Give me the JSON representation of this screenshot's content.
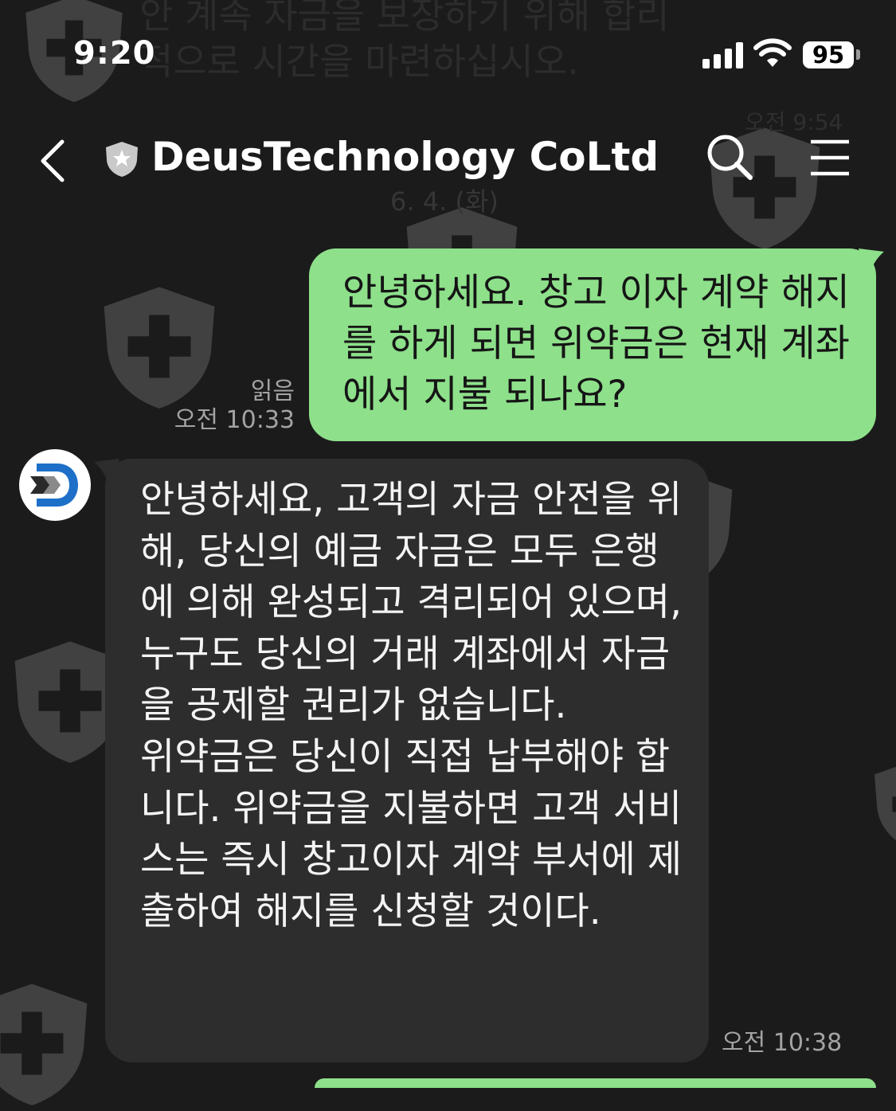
{
  "status_bar": {
    "time": "9:20",
    "battery": "95",
    "icons": [
      "signal-icon",
      "wifi-icon",
      "battery-icon"
    ]
  },
  "background_chat": {
    "partial_text": "안 계속 자금을 보장하기 위해 합리적으로 시간을 마련하십시오.",
    "partial_time": "오전 9:54",
    "date_divider": "6. 4. (화)"
  },
  "header": {
    "title": "DeusTechnology CoLtd",
    "icons": [
      "back-arrow-icon",
      "shield-star-icon",
      "search-icon",
      "menu-icon"
    ]
  },
  "messages": [
    {
      "direction": "outgoing",
      "text": "안녕하세요. 창고 이자 계약 해지를 하게 되면 위약금은 현재 계좌에서 지불 되나요?",
      "read_label": "읽음",
      "time": "오전 10:33"
    },
    {
      "direction": "incoming",
      "text": "안녕하세요, 고객의 자금 안전을 위해, 당신의 예금 자금은 모두 은행에 의해 완성되고 격리되어 있으며, 누구도 당신의 거래 계좌에서 자금을 공제할 권리가 없습니다.\n위약금은 당신이 직접 납부해야 합니다. 위약금을 지불하면 고객 서비스는 즉시 창고이자 계약 부서에 제출하여 해지를 신청할 것이다.",
      "time": "오전 10:38"
    }
  ],
  "colors": {
    "background": "#1b1b1b",
    "outgoing_bubble": "#8ee08b",
    "incoming_bubble": "#2d2d2d",
    "timestamp": "#a3a3a3"
  }
}
